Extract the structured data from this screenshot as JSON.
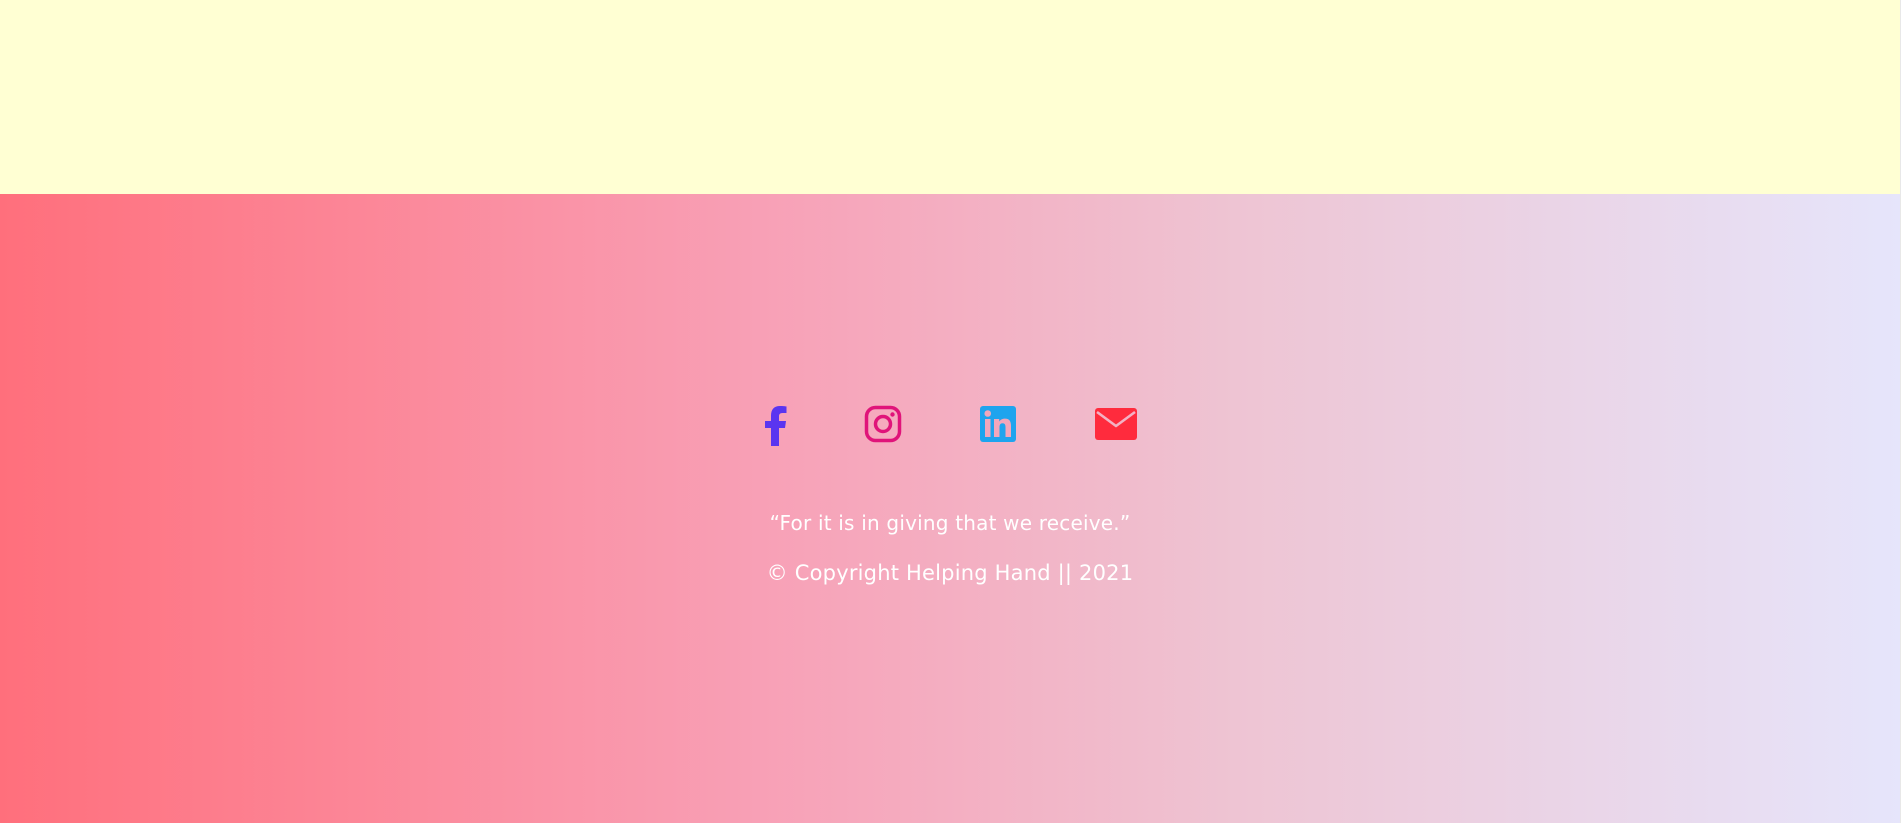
{
  "footer": {
    "quote": "“For it is in giving that we receive.”",
    "copyright": "© Copyright Helping Hand || 2021",
    "social_links": [
      {
        "name": "facebook",
        "icon": "facebook-icon",
        "color": "#5a35f0"
      },
      {
        "name": "instagram",
        "icon": "instagram-icon",
        "color": "#e0147a"
      },
      {
        "name": "linkedin",
        "icon": "linkedin-icon",
        "color": "#1ea4ee"
      },
      {
        "name": "email",
        "icon": "envelope-icon",
        "color": "#ff2b3d"
      }
    ]
  },
  "colors": {
    "top_background": "#ffffd3",
    "gradient_start": "#ff6f7c",
    "gradient_end": "#e6e5fb",
    "text": "#ffffff"
  }
}
